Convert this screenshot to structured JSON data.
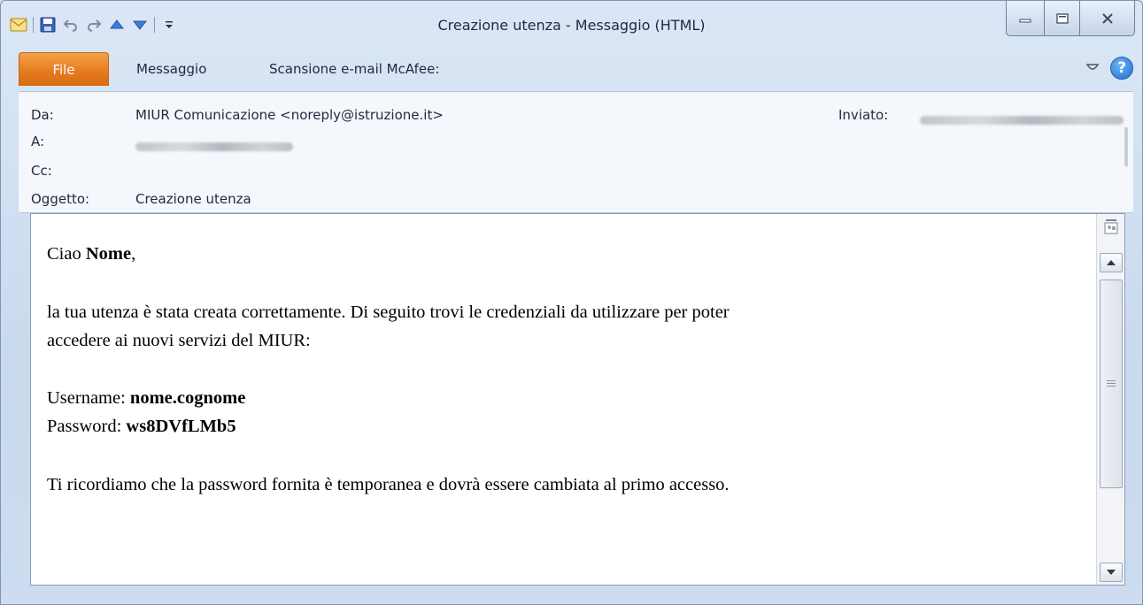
{
  "window": {
    "title": "Creazione utenza  -  Messaggio (HTML)"
  },
  "ribbon": {
    "file_label": "File",
    "tabs": [
      {
        "label": "Messaggio"
      },
      {
        "label": "Scansione e-mail McAfee:"
      }
    ]
  },
  "header": {
    "from_label": "Da:",
    "from_value": "MIUR Comunicazione <noreply@istruzione.it>",
    "to_label": "A:",
    "cc_label": "Cc:",
    "subject_label": "Oggetto:",
    "subject_value": "Creazione utenza",
    "sent_label": "Inviato:"
  },
  "message": {
    "greeting_prefix": "Ciao ",
    "greeting_name": "Nome",
    "greeting_suffix": ",",
    "line1": "la tua utenza è stata creata correttamente. Di seguito trovi le credenziali da utilizzare per poter",
    "line2": "accedere ai nuovi servizi del MIUR:",
    "username_label": "Username: ",
    "username_value": "nome.cognome",
    "password_label": "Password: ",
    "password_value": "ws8DVfLMb5",
    "closing": "Ti ricordiamo che la password fornita è temporanea e dovrà essere cambiata al primo accesso."
  },
  "colors": {
    "file_tab": "#e4781c",
    "help_icon": "#1f6fd1",
    "frame": "#c9d9ee"
  },
  "icons": [
    "mail-icon",
    "save-icon",
    "undo-icon",
    "redo-icon",
    "previous-item-icon",
    "next-item-icon",
    "customize-toolbar-icon",
    "minimize-icon",
    "restore-icon",
    "close-icon",
    "collapse-ribbon-icon",
    "help-icon",
    "people-pane-icon",
    "scroll-up-icon",
    "scroll-down-icon"
  ]
}
